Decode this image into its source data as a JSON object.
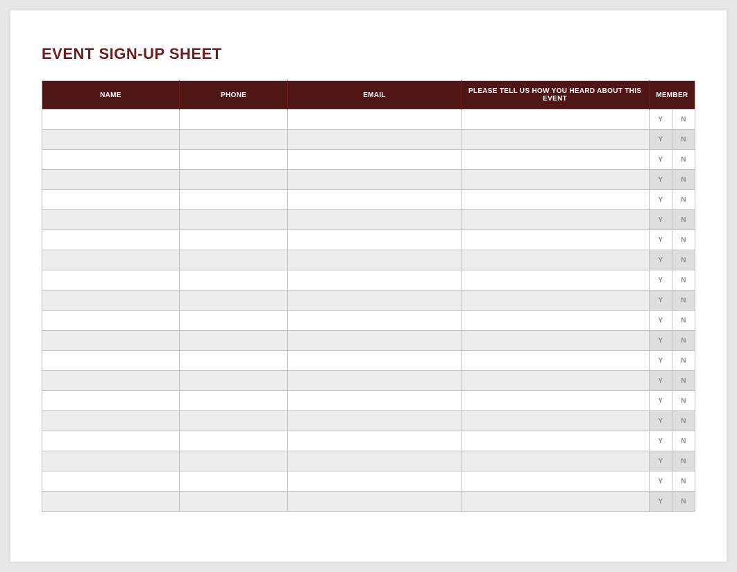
{
  "title": "EVENT SIGN-UP SHEET",
  "headers": {
    "name": "NAME",
    "phone": "PHONE",
    "email": "EMAIL",
    "heard": "PLEASE TELL US HOW YOU HEARD ABOUT THIS EVENT",
    "member": "MEMBER"
  },
  "member_options": {
    "y": "Y",
    "n": "N"
  },
  "row_count": 20
}
